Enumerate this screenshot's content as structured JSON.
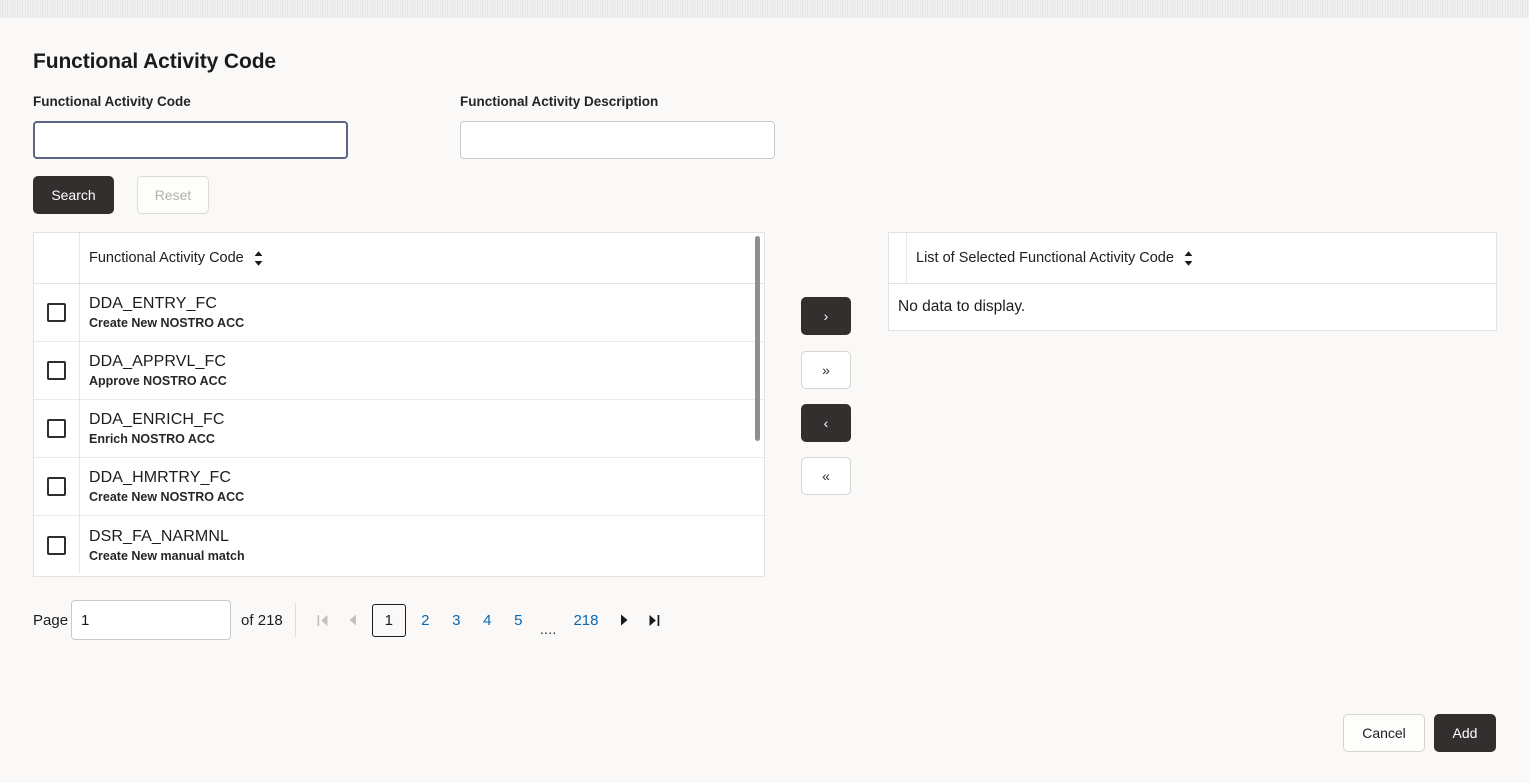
{
  "page": {
    "title": "Functional Activity Code"
  },
  "search_form": {
    "code_label": "Functional Activity Code",
    "code_value": "",
    "code_placeholder": "",
    "description_label": "Functional Activity Description",
    "description_value": "",
    "description_placeholder": "",
    "search_button": "Search",
    "reset_button": "Reset"
  },
  "available_table": {
    "column_header": "Functional Activity Code",
    "sort_icon": "sort-updown-icon",
    "rows": [
      {
        "code": "DDA_ENTRY_FC",
        "description": "Create New NOSTRO ACC",
        "checked": false
      },
      {
        "code": "DDA_APPRVL_FC",
        "description": "Approve NOSTRO ACC",
        "checked": false
      },
      {
        "code": "DDA_ENRICH_FC",
        "description": "Enrich NOSTRO ACC",
        "checked": false
      },
      {
        "code": "DDA_HMRTRY_FC",
        "description": "Create New NOSTRO ACC",
        "checked": false
      },
      {
        "code": "DSR_FA_NARMNL",
        "description": "Create New manual match",
        "checked": false
      }
    ]
  },
  "transfer_buttons": [
    {
      "name": "move-right",
      "glyph": "›",
      "style": "dark"
    },
    {
      "name": "move-all-right",
      "glyph": "»",
      "style": "light"
    },
    {
      "name": "move-left",
      "glyph": "‹",
      "style": "dark"
    },
    {
      "name": "move-all-left",
      "glyph": "«",
      "style": "light"
    }
  ],
  "selected_table": {
    "column_header": "List of Selected Functional Activity Code",
    "sort_icon": "sort-updown-icon",
    "empty_message": "No data to display."
  },
  "pagination": {
    "page_label": "Page",
    "page_value": "1",
    "of_text": "of 218",
    "total_pages": 218,
    "current_page": 1,
    "first_icon": "first-page-icon",
    "prev_icon": "prev-page-icon",
    "next_icon": "next-page-icon",
    "last_icon": "last-page-icon",
    "pages": [
      "1",
      "2",
      "3",
      "4",
      "5"
    ],
    "ellipsis": "....",
    "last_page": "218"
  },
  "footer": {
    "cancel_button": "Cancel",
    "add_button": "Add"
  },
  "colors": {
    "page_background": "#faf9f7",
    "primary_button": "#332f2e",
    "focus_border": "#5d6682",
    "link": "#0a68b0",
    "border": "#e4e2e0"
  }
}
